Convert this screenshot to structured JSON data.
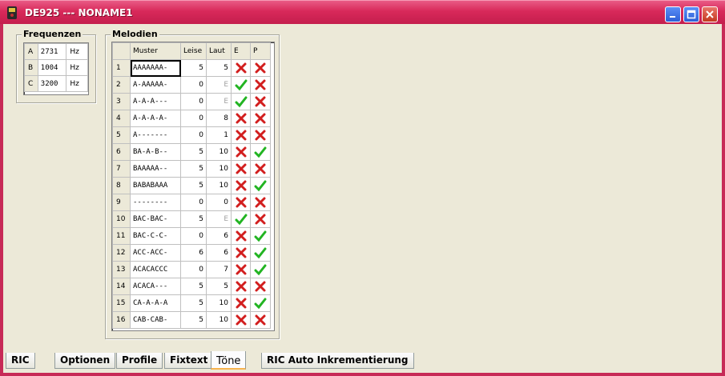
{
  "window": {
    "title": "DE925 --- NONAME1"
  },
  "frequenzen": {
    "title": "Frequenzen",
    "rows": [
      {
        "label": "A",
        "value": "2731",
        "unit": "Hz"
      },
      {
        "label": "B",
        "value": "1004",
        "unit": "Hz"
      },
      {
        "label": "C",
        "value": "3200",
        "unit": "Hz"
      }
    ]
  },
  "melodien": {
    "title": "Melodien",
    "columns": [
      "",
      "Muster",
      "Leise",
      "Laut",
      "E",
      "P"
    ],
    "rows": [
      {
        "n": "1",
        "muster": "AAAAAAA-",
        "leise": "5",
        "laut": "5",
        "e": false,
        "p": false
      },
      {
        "n": "2",
        "muster": "A-AAAAA-",
        "leise": "0",
        "laut": "E",
        "e": true,
        "p": false
      },
      {
        "n": "3",
        "muster": "A-A-A---",
        "leise": "0",
        "laut": "E",
        "e": true,
        "p": false
      },
      {
        "n": "4",
        "muster": "A-A-A-A-",
        "leise": "0",
        "laut": "8",
        "e": false,
        "p": false
      },
      {
        "n": "5",
        "muster": "A-------",
        "leise": "0",
        "laut": "1",
        "e": false,
        "p": false
      },
      {
        "n": "6",
        "muster": "BA-A-B--",
        "leise": "5",
        "laut": "10",
        "e": false,
        "p": true
      },
      {
        "n": "7",
        "muster": "BAAAAA--",
        "leise": "5",
        "laut": "10",
        "e": false,
        "p": false
      },
      {
        "n": "8",
        "muster": "BABABAAA",
        "leise": "5",
        "laut": "10",
        "e": false,
        "p": true
      },
      {
        "n": "9",
        "muster": "--------",
        "leise": "0",
        "laut": "0",
        "e": false,
        "p": false
      },
      {
        "n": "10",
        "muster": "BAC-BAC-",
        "leise": "5",
        "laut": "E",
        "e": true,
        "p": false
      },
      {
        "n": "11",
        "muster": "BAC-C-C-",
        "leise": "0",
        "laut": "6",
        "e": false,
        "p": true
      },
      {
        "n": "12",
        "muster": "ACC-ACC-",
        "leise": "6",
        "laut": "6",
        "e": false,
        "p": true
      },
      {
        "n": "13",
        "muster": "ACACACCC",
        "leise": "0",
        "laut": "7",
        "e": false,
        "p": true
      },
      {
        "n": "14",
        "muster": "ACACA---",
        "leise": "5",
        "laut": "5",
        "e": false,
        "p": false
      },
      {
        "n": "15",
        "muster": "CA-A-A-A",
        "leise": "5",
        "laut": "10",
        "e": false,
        "p": true
      },
      {
        "n": "16",
        "muster": "CAB-CAB-",
        "leise": "5",
        "laut": "10",
        "e": false,
        "p": false
      }
    ]
  },
  "tabs": [
    {
      "label": "RIC",
      "active": false
    },
    {
      "label": "Optionen",
      "active": false
    },
    {
      "label": "Profile",
      "active": false
    },
    {
      "label": "Fixtext",
      "active": false
    },
    {
      "label": "Töne",
      "active": true
    },
    {
      "label": "RIC Auto Inkrementierung",
      "active": false
    }
  ],
  "colors": {
    "check": "#22b422",
    "cross": "#d21e1e",
    "titlebar": "#d8295a"
  },
  "icons": {
    "true": "check-icon",
    "false": "cross-icon"
  }
}
